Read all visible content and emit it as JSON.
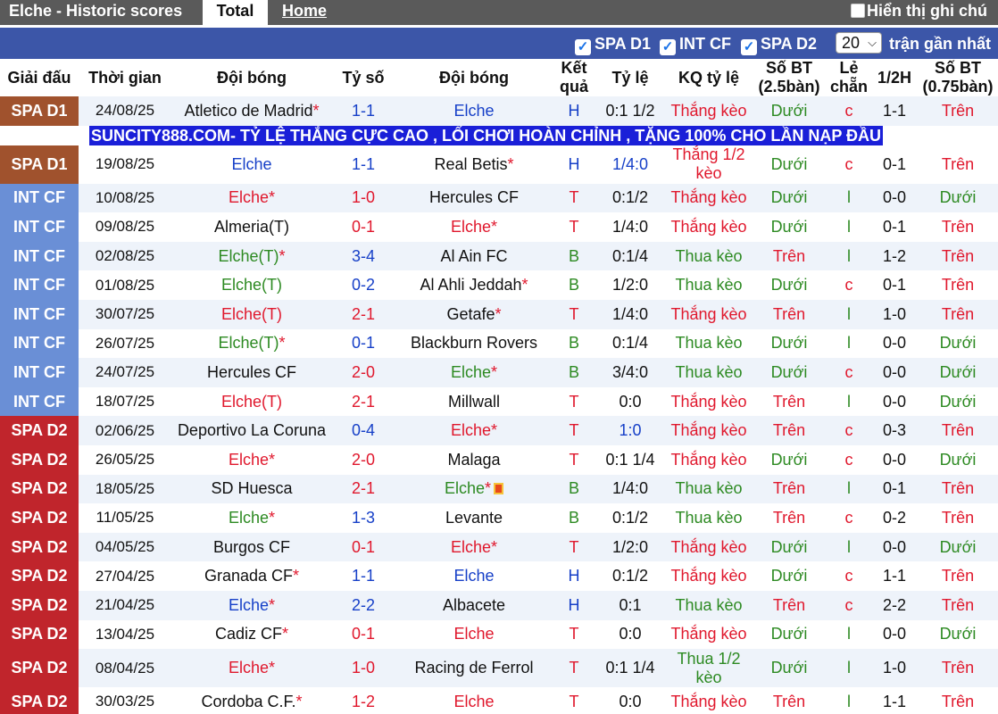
{
  "topbar": {
    "title": "Elche - Historic scores",
    "tab_total": "Total",
    "tab_home": "Home",
    "option_label": "Hiển thị ghi chú"
  },
  "filters": {
    "items": [
      {
        "label": "SPA D1",
        "checked": true
      },
      {
        "label": "INT CF",
        "checked": true
      },
      {
        "label": "SPA D2",
        "checked": true
      }
    ],
    "count_value": "20",
    "recent_label": "trận gần nhất"
  },
  "headers": {
    "league": "Giải đấu",
    "time": "Thời gian",
    "home": "Đội bóng",
    "score": "Tỷ số",
    "away": "Đội bóng",
    "result": "Kết quả",
    "odds": "Tỷ lệ",
    "odds_result": "KQ tỷ lệ",
    "goals": "Số BT (2.5bàn)",
    "odd_even": "Lẻ chẵn",
    "half": "1/2H",
    "goals2": "Số BT (0.75bàn)"
  },
  "banner": "SUNCITY888.COM- TỶ LỆ THẮNG CỰC CAO , LỐI CHƠI HOÀN CHỈNH , TẶNG 100% CHO LẦN NẠP ĐẦU",
  "colors": {
    "spa_d1": "#a0522d",
    "int_cf": "#6a8fd6",
    "spa_d2": "#c0252c",
    "win": "#e0182d",
    "draw": "#1740c8",
    "lose": "#2d8a22"
  },
  "rows": [
    {
      "league": "SPA D1",
      "date": "24/08/25",
      "home": "Atletico de Madrid",
      "home_star": "*",
      "home_c": "",
      "score": "1-1",
      "score_c": "blue",
      "away": "Elche",
      "away_star": "",
      "away_c": "blue",
      "res": "H",
      "res_c": "blue",
      "odds": "0:1 1/2",
      "odds_c": "",
      "kq": "Thắng kèo",
      "kq_c": "red",
      "bt": "Dưới",
      "bt_c": "green",
      "le": "c",
      "le_c": "red",
      "half": "1-1",
      "bt2": "Trên",
      "bt2_c": "red"
    },
    {
      "league": "SPA D1",
      "date": "19/08/25",
      "home": "Elche",
      "home_star": "",
      "home_c": "blue",
      "score": "1-1",
      "score_c": "blue",
      "away": "Real Betis",
      "away_star": "*",
      "away_c": "",
      "res": "H",
      "res_c": "blue",
      "odds": "1/4:0",
      "odds_c": "blue",
      "kq": "Thắng 1/2 kèo",
      "kq_c": "red",
      "bt": "Dưới",
      "bt_c": "green",
      "le": "c",
      "le_c": "red",
      "half": "0-1",
      "bt2": "Trên",
      "bt2_c": "red",
      "tall": true
    },
    {
      "league": "INT CF",
      "date": "10/08/25",
      "home": "Elche",
      "home_star": "*",
      "home_c": "red",
      "score": "1-0",
      "score_c": "red",
      "away": "Hercules CF",
      "away_star": "",
      "away_c": "",
      "res": "T",
      "res_c": "red",
      "odds": "0:1/2",
      "odds_c": "",
      "kq": "Thắng kèo",
      "kq_c": "red",
      "bt": "Dưới",
      "bt_c": "green",
      "le": "l",
      "le_c": "green",
      "half": "0-0",
      "bt2": "Dưới",
      "bt2_c": "green"
    },
    {
      "league": "INT CF",
      "date": "09/08/25",
      "home": "Almeria(T)",
      "home_star": "",
      "home_c": "",
      "score": "0-1",
      "score_c": "red",
      "away": "Elche",
      "away_star": "*",
      "away_c": "red",
      "res": "T",
      "res_c": "red",
      "odds": "1/4:0",
      "odds_c": "",
      "kq": "Thắng kèo",
      "kq_c": "red",
      "bt": "Dưới",
      "bt_c": "green",
      "le": "l",
      "le_c": "green",
      "half": "0-1",
      "bt2": "Trên",
      "bt2_c": "red"
    },
    {
      "league": "INT CF",
      "date": "02/08/25",
      "home": "Elche(T)",
      "home_star": "*",
      "home_c": "green",
      "score": "3-4",
      "score_c": "blue",
      "away": "Al Ain FC",
      "away_star": "",
      "away_c": "",
      "res": "B",
      "res_c": "green",
      "odds": "0:1/4",
      "odds_c": "",
      "kq": "Thua kèo",
      "kq_c": "green",
      "bt": "Trên",
      "bt_c": "red",
      "le": "l",
      "le_c": "green",
      "half": "1-2",
      "bt2": "Trên",
      "bt2_c": "red"
    },
    {
      "league": "INT CF",
      "date": "01/08/25",
      "home": "Elche(T)",
      "home_star": "",
      "home_c": "green",
      "score": "0-2",
      "score_c": "blue",
      "away": "Al Ahli Jeddah",
      "away_star": "*",
      "away_c": "",
      "res": "B",
      "res_c": "green",
      "odds": "1/2:0",
      "odds_c": "",
      "kq": "Thua kèo",
      "kq_c": "green",
      "bt": "Dưới",
      "bt_c": "green",
      "le": "c",
      "le_c": "red",
      "half": "0-1",
      "bt2": "Trên",
      "bt2_c": "red"
    },
    {
      "league": "INT CF",
      "date": "30/07/25",
      "home": "Elche(T)",
      "home_star": "",
      "home_c": "red",
      "score": "2-1",
      "score_c": "red",
      "away": "Getafe",
      "away_star": "*",
      "away_c": "",
      "res": "T",
      "res_c": "red",
      "odds": "1/4:0",
      "odds_c": "",
      "kq": "Thắng kèo",
      "kq_c": "red",
      "bt": "Trên",
      "bt_c": "red",
      "le": "l",
      "le_c": "green",
      "half": "1-0",
      "bt2": "Trên",
      "bt2_c": "red"
    },
    {
      "league": "INT CF",
      "date": "26/07/25",
      "home": "Elche(T)",
      "home_star": "*",
      "home_c": "green",
      "score": "0-1",
      "score_c": "blue",
      "away": "Blackburn Rovers",
      "away_star": "",
      "away_c": "",
      "res": "B",
      "res_c": "green",
      "odds": "0:1/4",
      "odds_c": "",
      "kq": "Thua kèo",
      "kq_c": "green",
      "bt": "Dưới",
      "bt_c": "green",
      "le": "l",
      "le_c": "green",
      "half": "0-0",
      "bt2": "Dưới",
      "bt2_c": "green"
    },
    {
      "league": "INT CF",
      "date": "24/07/25",
      "home": "Hercules CF",
      "home_star": "",
      "home_c": "",
      "score": "2-0",
      "score_c": "red",
      "away": "Elche",
      "away_star": "*",
      "away_c": "green",
      "res": "B",
      "res_c": "green",
      "odds": "3/4:0",
      "odds_c": "",
      "kq": "Thua kèo",
      "kq_c": "green",
      "bt": "Dưới",
      "bt_c": "green",
      "le": "c",
      "le_c": "red",
      "half": "0-0",
      "bt2": "Dưới",
      "bt2_c": "green"
    },
    {
      "league": "INT CF",
      "date": "18/07/25",
      "home": "Elche(T)",
      "home_star": "",
      "home_c": "red",
      "score": "2-1",
      "score_c": "red",
      "away": "Millwall",
      "away_star": "",
      "away_c": "",
      "res": "T",
      "res_c": "red",
      "odds": "0:0",
      "odds_c": "",
      "kq": "Thắng kèo",
      "kq_c": "red",
      "bt": "Trên",
      "bt_c": "red",
      "le": "l",
      "le_c": "green",
      "half": "0-0",
      "bt2": "Dưới",
      "bt2_c": "green"
    },
    {
      "league": "SPA D2",
      "date": "02/06/25",
      "home": "Deportivo La Coruna",
      "home_star": "",
      "home_c": "",
      "score": "0-4",
      "score_c": "blue",
      "away": "Elche",
      "away_star": "*",
      "away_c": "red",
      "res": "T",
      "res_c": "red",
      "odds": "1:0",
      "odds_c": "blue",
      "kq": "Thắng kèo",
      "kq_c": "red",
      "bt": "Trên",
      "bt_c": "red",
      "le": "c",
      "le_c": "red",
      "half": "0-3",
      "bt2": "Trên",
      "bt2_c": "red"
    },
    {
      "league": "SPA D2",
      "date": "26/05/25",
      "home": "Elche",
      "home_star": "*",
      "home_c": "red",
      "score": "2-0",
      "score_c": "red",
      "away": "Malaga",
      "away_star": "",
      "away_c": "",
      "res": "T",
      "res_c": "red",
      "odds": "0:1 1/4",
      "odds_c": "",
      "kq": "Thắng kèo",
      "kq_c": "red",
      "bt": "Dưới",
      "bt_c": "green",
      "le": "c",
      "le_c": "red",
      "half": "0-0",
      "bt2": "Dưới",
      "bt2_c": "green"
    },
    {
      "league": "SPA D2",
      "date": "18/05/25",
      "home": "SD Huesca",
      "home_star": "",
      "home_c": "",
      "score": "2-1",
      "score_c": "red",
      "away": "Elche",
      "away_star": "*",
      "away_c": "green",
      "away_flag": true,
      "res": "B",
      "res_c": "green",
      "odds": "1/4:0",
      "odds_c": "",
      "kq": "Thua kèo",
      "kq_c": "green",
      "bt": "Trên",
      "bt_c": "red",
      "le": "l",
      "le_c": "green",
      "half": "0-1",
      "bt2": "Trên",
      "bt2_c": "red"
    },
    {
      "league": "SPA D2",
      "date": "11/05/25",
      "home": "Elche",
      "home_star": "*",
      "home_c": "green",
      "score": "1-3",
      "score_c": "blue",
      "away": "Levante",
      "away_star": "",
      "away_c": "",
      "res": "B",
      "res_c": "green",
      "odds": "0:1/2",
      "odds_c": "",
      "kq": "Thua kèo",
      "kq_c": "green",
      "bt": "Trên",
      "bt_c": "red",
      "le": "c",
      "le_c": "red",
      "half": "0-2",
      "bt2": "Trên",
      "bt2_c": "red"
    },
    {
      "league": "SPA D2",
      "date": "04/05/25",
      "home": "Burgos CF",
      "home_star": "",
      "home_c": "",
      "score": "0-1",
      "score_c": "red",
      "away": "Elche",
      "away_star": "*",
      "away_c": "red",
      "res": "T",
      "res_c": "red",
      "odds": "1/2:0",
      "odds_c": "",
      "kq": "Thắng kèo",
      "kq_c": "red",
      "bt": "Dưới",
      "bt_c": "green",
      "le": "l",
      "le_c": "green",
      "half": "0-0",
      "bt2": "Dưới",
      "bt2_c": "green"
    },
    {
      "league": "SPA D2",
      "date": "27/04/25",
      "home": "Granada CF",
      "home_star": "*",
      "home_c": "",
      "score": "1-1",
      "score_c": "blue",
      "away": "Elche",
      "away_star": "",
      "away_c": "blue",
      "res": "H",
      "res_c": "blue",
      "odds": "0:1/2",
      "odds_c": "",
      "kq": "Thắng kèo",
      "kq_c": "red",
      "bt": "Dưới",
      "bt_c": "green",
      "le": "c",
      "le_c": "red",
      "half": "1-1",
      "bt2": "Trên",
      "bt2_c": "red"
    },
    {
      "league": "SPA D2",
      "date": "21/04/25",
      "home": "Elche",
      "home_star": "*",
      "home_c": "blue",
      "score": "2-2",
      "score_c": "blue",
      "away": "Albacete",
      "away_star": "",
      "away_c": "",
      "res": "H",
      "res_c": "blue",
      "odds": "0:1",
      "odds_c": "",
      "kq": "Thua kèo",
      "kq_c": "green",
      "bt": "Trên",
      "bt_c": "red",
      "le": "c",
      "le_c": "red",
      "half": "2-2",
      "bt2": "Trên",
      "bt2_c": "red"
    },
    {
      "league": "SPA D2",
      "date": "13/04/25",
      "home": "Cadiz CF",
      "home_star": "*",
      "home_c": "",
      "score": "0-1",
      "score_c": "red",
      "away": "Elche",
      "away_star": "",
      "away_c": "red",
      "res": "T",
      "res_c": "red",
      "odds": "0:0",
      "odds_c": "",
      "kq": "Thắng kèo",
      "kq_c": "red",
      "bt": "Dưới",
      "bt_c": "green",
      "le": "l",
      "le_c": "green",
      "half": "0-0",
      "bt2": "Dưới",
      "bt2_c": "green"
    },
    {
      "league": "SPA D2",
      "date": "08/04/25",
      "home": "Elche",
      "home_star": "*",
      "home_c": "red",
      "score": "1-0",
      "score_c": "red",
      "away": "Racing de Ferrol",
      "away_star": "",
      "away_c": "",
      "res": "T",
      "res_c": "red",
      "odds": "0:1 1/4",
      "odds_c": "",
      "kq": "Thua 1/2 kèo",
      "kq_c": "green",
      "bt": "Dưới",
      "bt_c": "green",
      "le": "l",
      "le_c": "green",
      "half": "1-0",
      "bt2": "Trên",
      "bt2_c": "red",
      "tall": true
    },
    {
      "league": "SPA D2",
      "date": "30/03/25",
      "home": "Cordoba C.F.",
      "home_star": "*",
      "home_c": "",
      "score": "1-2",
      "score_c": "red",
      "away": "Elche",
      "away_star": "",
      "away_c": "red",
      "res": "T",
      "res_c": "red",
      "odds": "0:0",
      "odds_c": "",
      "kq": "Thắng kèo",
      "kq_c": "red",
      "bt": "Trên",
      "bt_c": "red",
      "le": "l",
      "le_c": "green",
      "half": "1-1",
      "bt2": "Trên",
      "bt2_c": "red"
    }
  ]
}
